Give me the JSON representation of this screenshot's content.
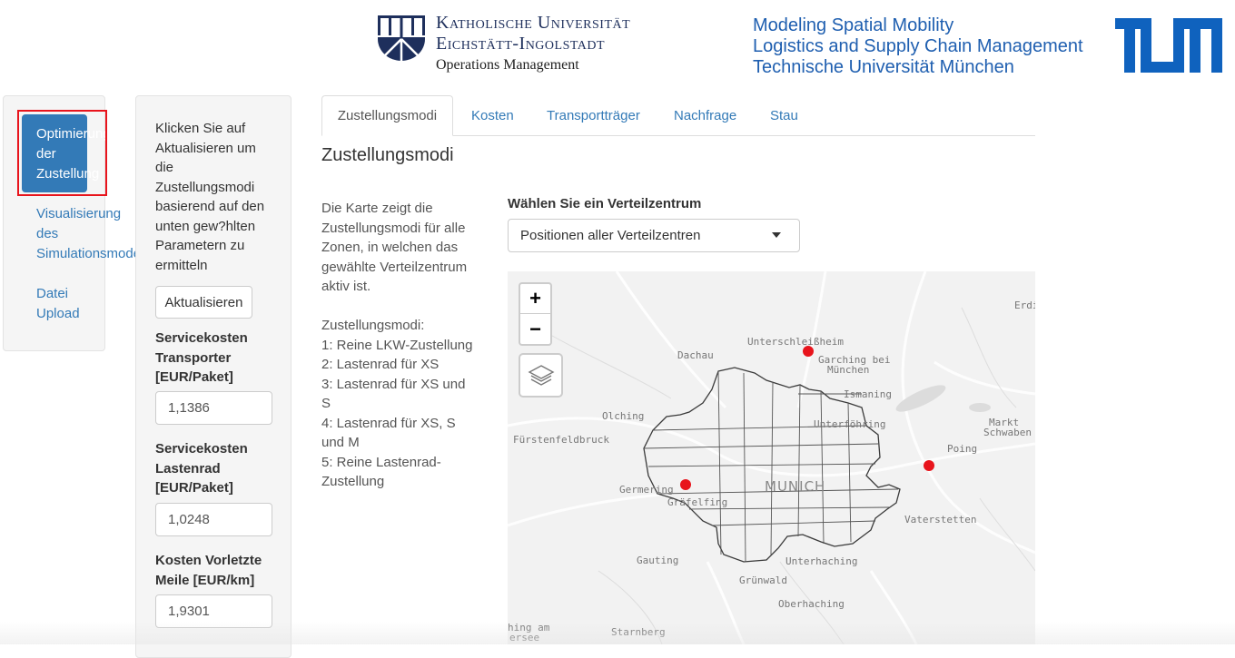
{
  "header": {
    "ku_line1": "Katholische Universität",
    "ku_line2": "Eichstätt-Ingolstadt",
    "ku_line3": "Operations Management",
    "tum_line1": "Modeling Spatial Mobility",
    "tum_line2": "Logistics and Supply Chain Management",
    "tum_line3": "Technische Universität München",
    "tum_logo_text": "TUM"
  },
  "nav": {
    "active_label": "Optimierung der Zustellung",
    "active_lines": [
      "Optimierung",
      "der",
      "Zustellung"
    ],
    "visual_lines": [
      "Visualisierung",
      "des",
      "Simulationsmodells"
    ],
    "upload_lines": [
      "Datei",
      "Upload"
    ]
  },
  "params": {
    "help_text": "Klicken Sie auf Aktualisieren um die Zustellungsmodi basierend auf den unten gew?hlten Parametern zu ermitteln",
    "update_button": "Aktualisieren",
    "transporter_label": "Servicekosten Transporter [EUR/Paket]",
    "transporter_value": "1,1386",
    "cargobike_label": "Servicekosten Lastenrad [EUR/Paket]",
    "cargobike_value": "1,0248",
    "prelast_label": "Kosten Vorletzte Meile [EUR/km]",
    "prelast_value": "1,9301"
  },
  "tabs": [
    "Zustellungsmodi",
    "Kosten",
    "Transportträger",
    "Nachfrage",
    "Stau"
  ],
  "main": {
    "title": "Zustellungsmodi",
    "description": "Die Karte zeigt die Zustellungsmodi für alle Zonen, in welchen das gewählte Verteilzentrum aktiv ist.",
    "modes_heading": "Zustellungsmodi:",
    "modes": [
      "1: Reine LKW-Zustellung",
      "2: Lastenrad für XS",
      "3: Lastenrad für XS und S",
      "4: Lastenrad für XS, S und M",
      "5: Reine Lastenrad-Zustellung"
    ],
    "select_label": "Wählen Sie ein Verteilzentrum",
    "select_value": "Positionen aller Verteilzentren"
  },
  "map": {
    "zoom_in": "+",
    "zoom_out": "−",
    "marker_color": "#e8141c",
    "places": [
      "Erdi",
      "Unterschleißheim",
      "Garching bei",
      "München",
      "Dachau",
      "Ismaning",
      "Olching",
      "Unterföhring",
      "Markt",
      "Schwaben",
      "Fürstenfeldbruck",
      "Poing",
      "MUNICH",
      "Germering",
      "Gräfelfing",
      "Vaterstetten",
      "Gauting",
      "Unterhaching",
      "Grünwald",
      "Oberhaching",
      "hing am",
      "ersee",
      "Starnberg"
    ],
    "city_label": "MUNICH"
  }
}
